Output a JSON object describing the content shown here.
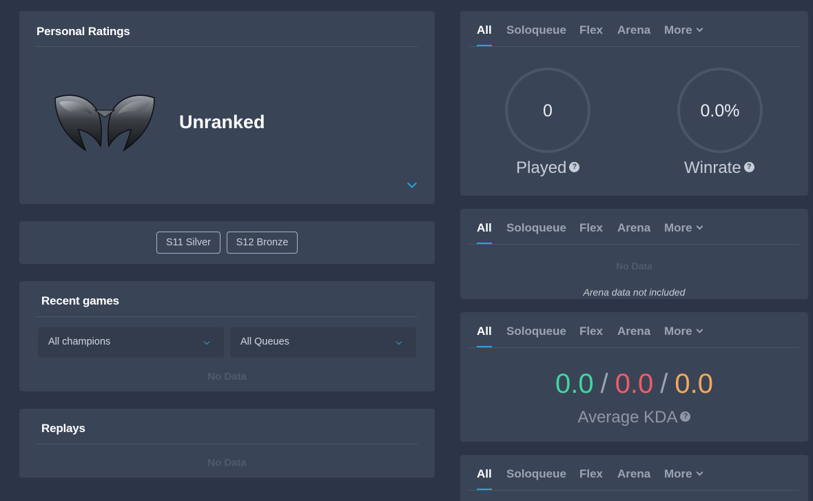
{
  "personal_ratings": {
    "title": "Personal Ratings",
    "rank": "Unranked",
    "emblem_icon": "unranked-emblem-icon",
    "expand_icon": "chevron-down-icon"
  },
  "seasons": {
    "tags": [
      "S11 Silver",
      "S12 Bronze"
    ]
  },
  "recent_games": {
    "title": "Recent games",
    "champion_filter": "All champions",
    "queue_filter": "All Queues",
    "empty": "No Data"
  },
  "replays": {
    "title": "Replays",
    "empty": "No Data"
  },
  "queue_tabs": {
    "all": "All",
    "soloqueue": "Soloqueue",
    "flex": "Flex",
    "arena": "Arena",
    "more": "More"
  },
  "stats": {
    "played_value": "0",
    "played_label": "Played",
    "winrate_value": "0.0%",
    "winrate_label": "Winrate",
    "help_glyph": "?"
  },
  "champions": {
    "empty": "No Data",
    "note": "Arena data not included"
  },
  "kda": {
    "kills": "0.0",
    "deaths": "0.0",
    "assists": "0.0",
    "separator": "/",
    "label": "Average KDA"
  },
  "colors": {
    "accent": "#27a3dc",
    "kills": "#3fd6a0",
    "deaths": "#f25c66",
    "assists": "#f5a85a"
  }
}
